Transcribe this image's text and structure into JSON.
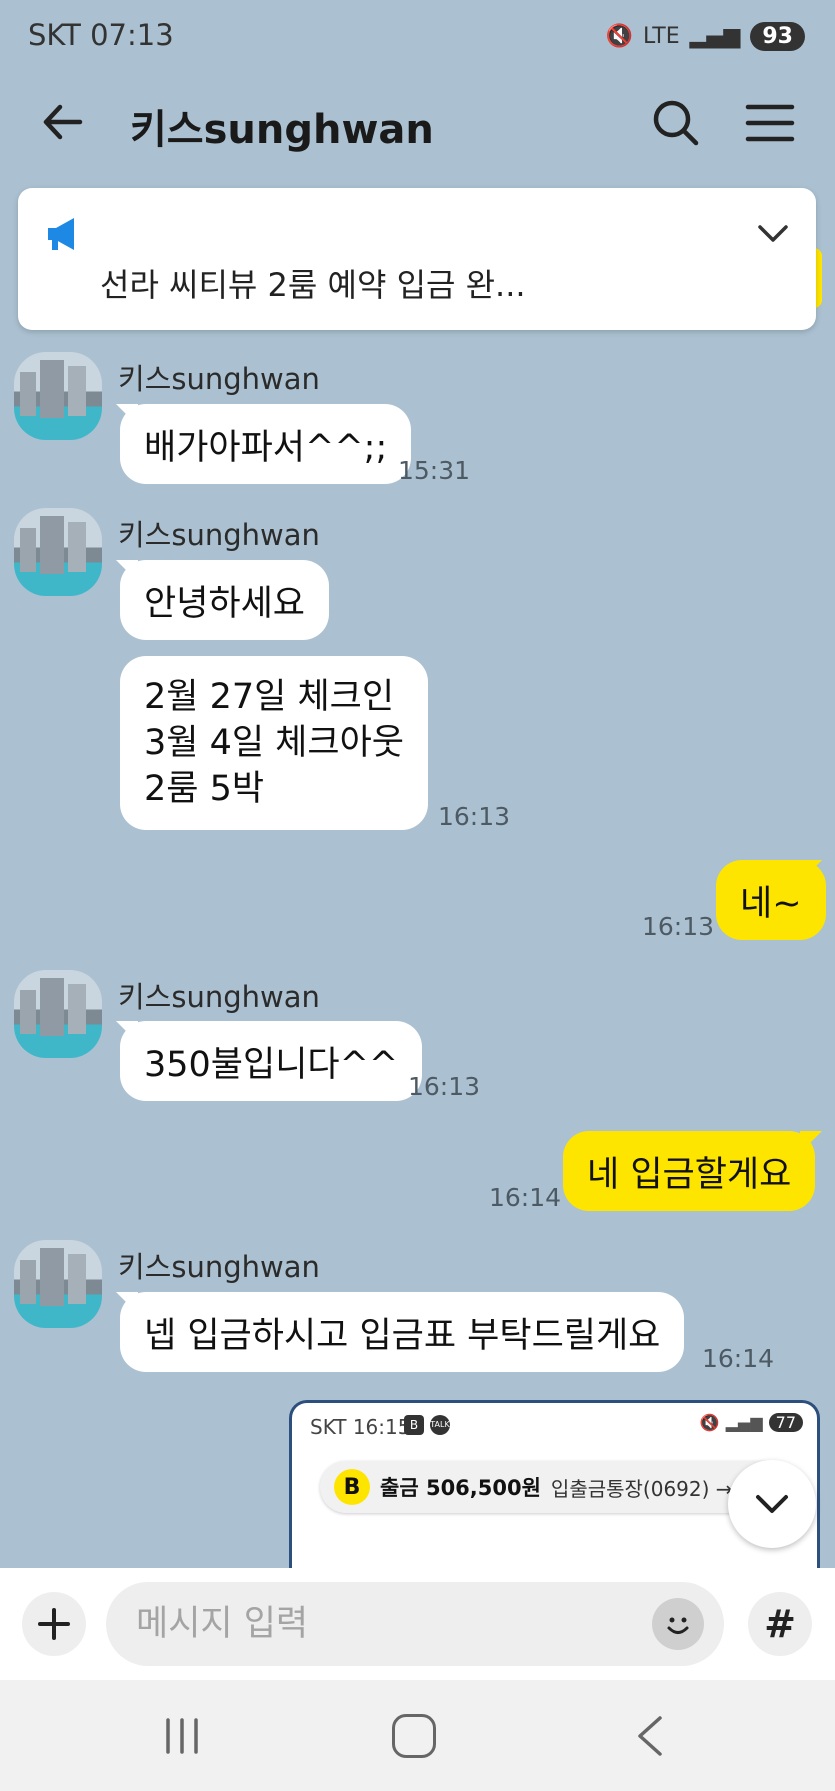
{
  "status_bar": {
    "carrier_time": "SKT 07:13",
    "battery": "93",
    "network": "LTE"
  },
  "header": {
    "title": "키스sunghwan"
  },
  "notice": {
    "text": "선라 씨티뷰  2룸 예약 입금 완..."
  },
  "messages": [
    {
      "sender": "키스sunghwan",
      "text": "배가아파서^^;;",
      "time": "15:31"
    },
    {
      "sender": "키스sunghwan",
      "text": "안녕하세요"
    },
    {
      "lines": [
        "2월 27일 체크인",
        "3월 4일 체크아웃",
        "2룸 5박"
      ],
      "time": "16:13"
    },
    {
      "mine": true,
      "text": "네~",
      "time": "16:13"
    },
    {
      "sender": "키스sunghwan",
      "text": "350불입니다^^",
      "time": "16:13"
    },
    {
      "mine": true,
      "text": "네 입금할게요",
      "time": "16:14"
    },
    {
      "sender": "키스sunghwan",
      "text": "넵 입금하시고 입금표 부탁드릴게요",
      "time": "16:14"
    }
  ],
  "shared_screenshot": {
    "carrier_time": "SKT 16:15",
    "battery": "77",
    "icon_badges": [
      "B",
      "TALK"
    ],
    "toast_bold": "출금 506,500원",
    "toast_text": "입출금통장(0692) → 고..."
  },
  "input": {
    "placeholder": "메시지 입력",
    "hash_label": "#"
  },
  "icons": {
    "back": "arrow-left-icon",
    "search": "search-icon",
    "menu": "hamburger-menu-icon",
    "notice": "megaphone-icon",
    "expand": "chevron-down-icon",
    "plus": "plus-icon",
    "emoji": "emoji-icon",
    "scroll": "chevron-down-icon"
  },
  "colors": {
    "background": "#abc1d1",
    "my_bubble": "#fee500",
    "other_bubble": "#ffffff",
    "notice_icon": "#1e88e5"
  }
}
